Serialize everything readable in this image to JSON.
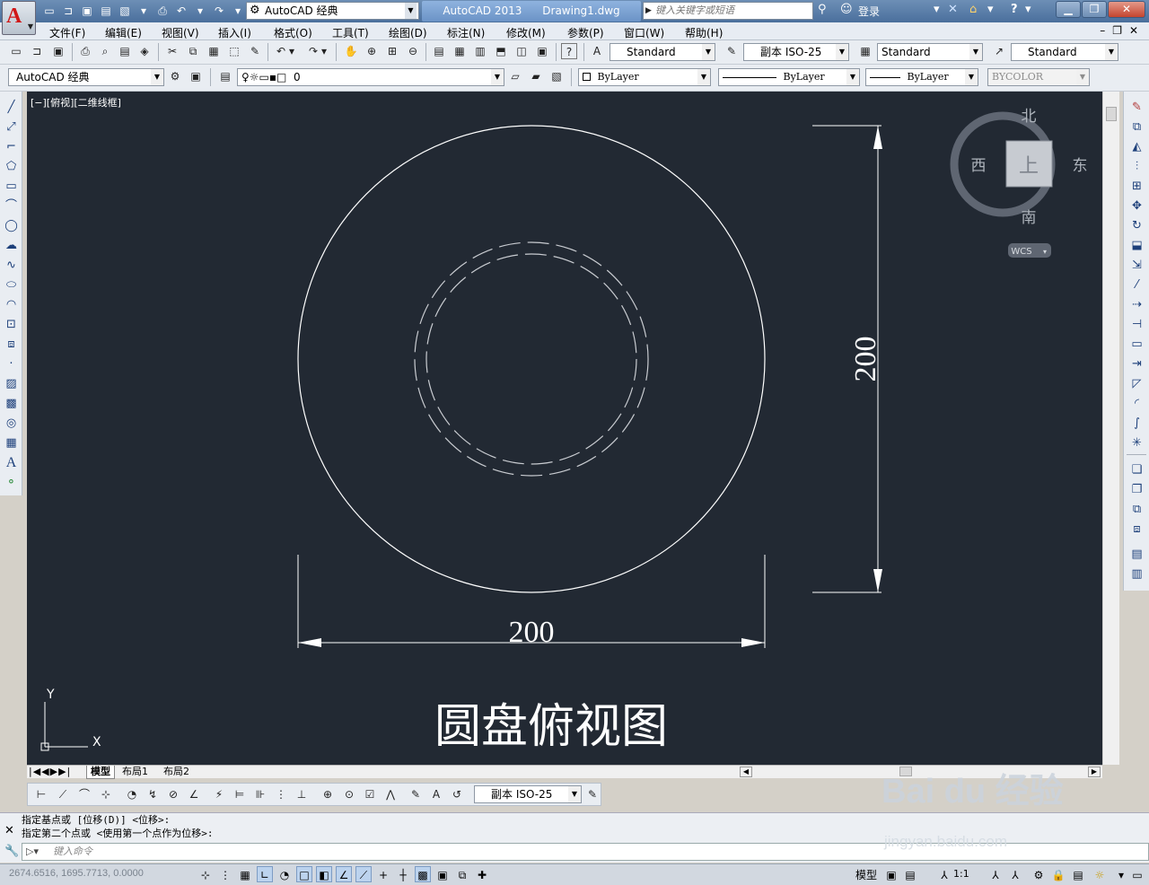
{
  "titlebar": {
    "workspace": "AutoCAD 经典",
    "app_name": "AutoCAD 2013",
    "document": "Drawing1.dwg",
    "search_placeholder": "键入关键字或短语",
    "login": "登录",
    "help": "?"
  },
  "menubar": {
    "items": [
      "文件(F)",
      "编辑(E)",
      "视图(V)",
      "插入(I)",
      "格式(O)",
      "工具(T)",
      "绘图(D)",
      "标注(N)",
      "修改(M)",
      "参数(P)",
      "窗口(W)",
      "帮助(H)"
    ]
  },
  "styles_toolbar": {
    "text_style": "Standard",
    "dim_style": "副本 ISO-25",
    "table_style": "Standard",
    "multileader_style": "Standard"
  },
  "properties_toolbar": {
    "workspace": "AutoCAD 经典",
    "layer": "0",
    "color": "ByLayer",
    "linetype": "ByLayer",
    "lineweight": "ByLayer",
    "plot_style": "BYCOLOR"
  },
  "viewport": {
    "label": "[−][俯视][二维线框]"
  },
  "viewcube": {
    "north": "北",
    "south": "南",
    "east": "东",
    "west": "西",
    "top_face": "上",
    "wcs": "WCS"
  },
  "drawing": {
    "dim_horizontal": "200",
    "dim_vertical": "200",
    "caption": "圆盘俯视图",
    "ucs_x": "X",
    "ucs_y": "Y"
  },
  "layout_tabs": [
    "模型",
    "布局1",
    "布局2"
  ],
  "dim_toolbar": {
    "dim_style": "副本 ISO-25"
  },
  "command_line": {
    "history_1": "指定基点或 [位移(D)] <位移>:",
    "history_2": "指定第二个点或 <使用第一个点作为位移>:",
    "input_placeholder": "键入命令"
  },
  "statusbar": {
    "coordinates": "2674.6516, 1695.7713, 0.0000",
    "model": "模型",
    "annotation_scale": "1:1"
  },
  "watermark": {
    "brand": "Bai du 经验",
    "url": "jingyan.baidu.com"
  },
  "colors": {
    "canvas": "#222933",
    "geometry": "#ffffff",
    "hidden_lines": "#c9ccd1",
    "accent": "#4a6f9c"
  }
}
